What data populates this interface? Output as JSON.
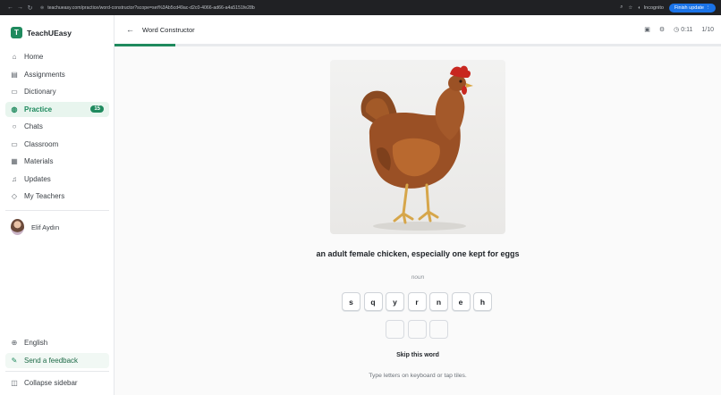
{
  "browser": {
    "url": "teachueasy.com/practice/word-constructor?scope=set%3Ab5cd49ac-d2c0-4066-ad66-a4a5151fe28b",
    "incognito_label": "Incognito",
    "finish_update_label": "Finish update"
  },
  "app": {
    "logo_letter": "T",
    "name": "TeachUEasy"
  },
  "sidebar": {
    "items": [
      {
        "label": "Home",
        "icon": "home-icon"
      },
      {
        "label": "Assignments",
        "icon": "clipboard-icon"
      },
      {
        "label": "Dictionary",
        "icon": "book-icon"
      },
      {
        "label": "Practice",
        "icon": "practice-icon",
        "badge": "15",
        "active": true
      },
      {
        "label": "Chats",
        "icon": "chat-icon"
      },
      {
        "label": "Classroom",
        "icon": "classroom-icon"
      },
      {
        "label": "Materials",
        "icon": "materials-icon"
      },
      {
        "label": "Updates",
        "icon": "bell-icon"
      },
      {
        "label": "My Teachers",
        "icon": "teachers-icon"
      }
    ],
    "user_name": "Elif Aydın",
    "language_label": "English",
    "feedback_label": "Send a feedback",
    "collapse_label": "Collapse sidebar"
  },
  "topbar": {
    "title": "Word Constructor",
    "timer": "0:11",
    "counter": "1/10"
  },
  "progress": {
    "fraction": 0.1
  },
  "exercise": {
    "definition": "an adult female chicken, especially one kept for eggs",
    "part_of_speech": "noun",
    "letters": [
      "s",
      "q",
      "y",
      "r",
      "n",
      "e",
      "h"
    ],
    "slot_count": 3,
    "skip_label": "Skip this word",
    "hint": "Type letters on keyboard or tap tiles."
  },
  "colors": {
    "accent": "#1f8a5e",
    "chrome": "#202124",
    "update_button": "#1a73e8"
  }
}
